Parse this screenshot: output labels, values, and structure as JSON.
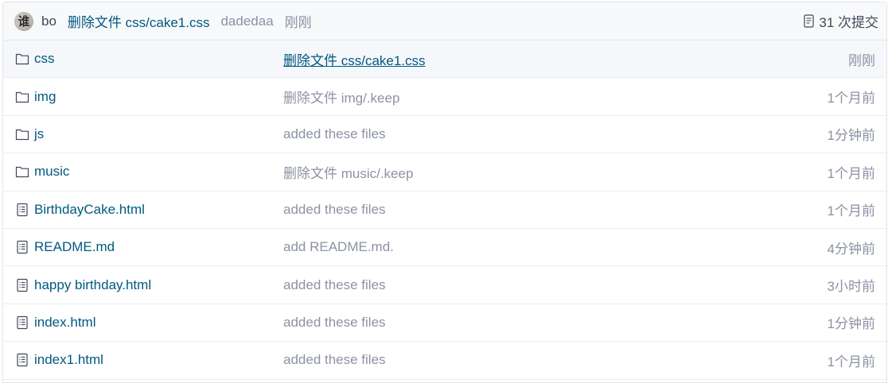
{
  "latest_commit": {
    "author": "bo",
    "message": "删除文件 css/cake1.css",
    "committer": "dadedaa",
    "time": "刚刚",
    "commit_count_label": "31 次提交"
  },
  "files": [
    {
      "type": "folder",
      "name": "css",
      "message": "删除文件 css/cake1.css",
      "time": "刚刚"
    },
    {
      "type": "folder",
      "name": "img",
      "message": "删除文件 img/.keep",
      "time": "1个月前"
    },
    {
      "type": "folder",
      "name": "js",
      "message": "added these files",
      "time": "1分钟前"
    },
    {
      "type": "folder",
      "name": "music",
      "message": "删除文件 music/.keep",
      "time": "1个月前"
    },
    {
      "type": "file",
      "name": "BirthdayCake.html",
      "message": "added these files",
      "time": "1个月前"
    },
    {
      "type": "file",
      "name": "README.md",
      "message": "add README.md.",
      "time": "4分钟前"
    },
    {
      "type": "file",
      "name": "happy birthday.html",
      "message": "added these files",
      "time": "3小时前"
    },
    {
      "type": "file",
      "name": "index.html",
      "message": "added these files",
      "time": "1分钟前"
    },
    {
      "type": "file",
      "name": "index1.html",
      "message": "added these files",
      "time": "1个月前"
    }
  ],
  "colors": {
    "link": "#005980",
    "muted": "#8c92a4",
    "text": "#40485b",
    "header_bg": "#f8f9fa",
    "highlight_bg": "#f5f7fa",
    "border": "#e3e5e8"
  },
  "icons": {
    "folder": "folder-icon",
    "file": "file-icon",
    "commits": "commit-history-icon"
  }
}
